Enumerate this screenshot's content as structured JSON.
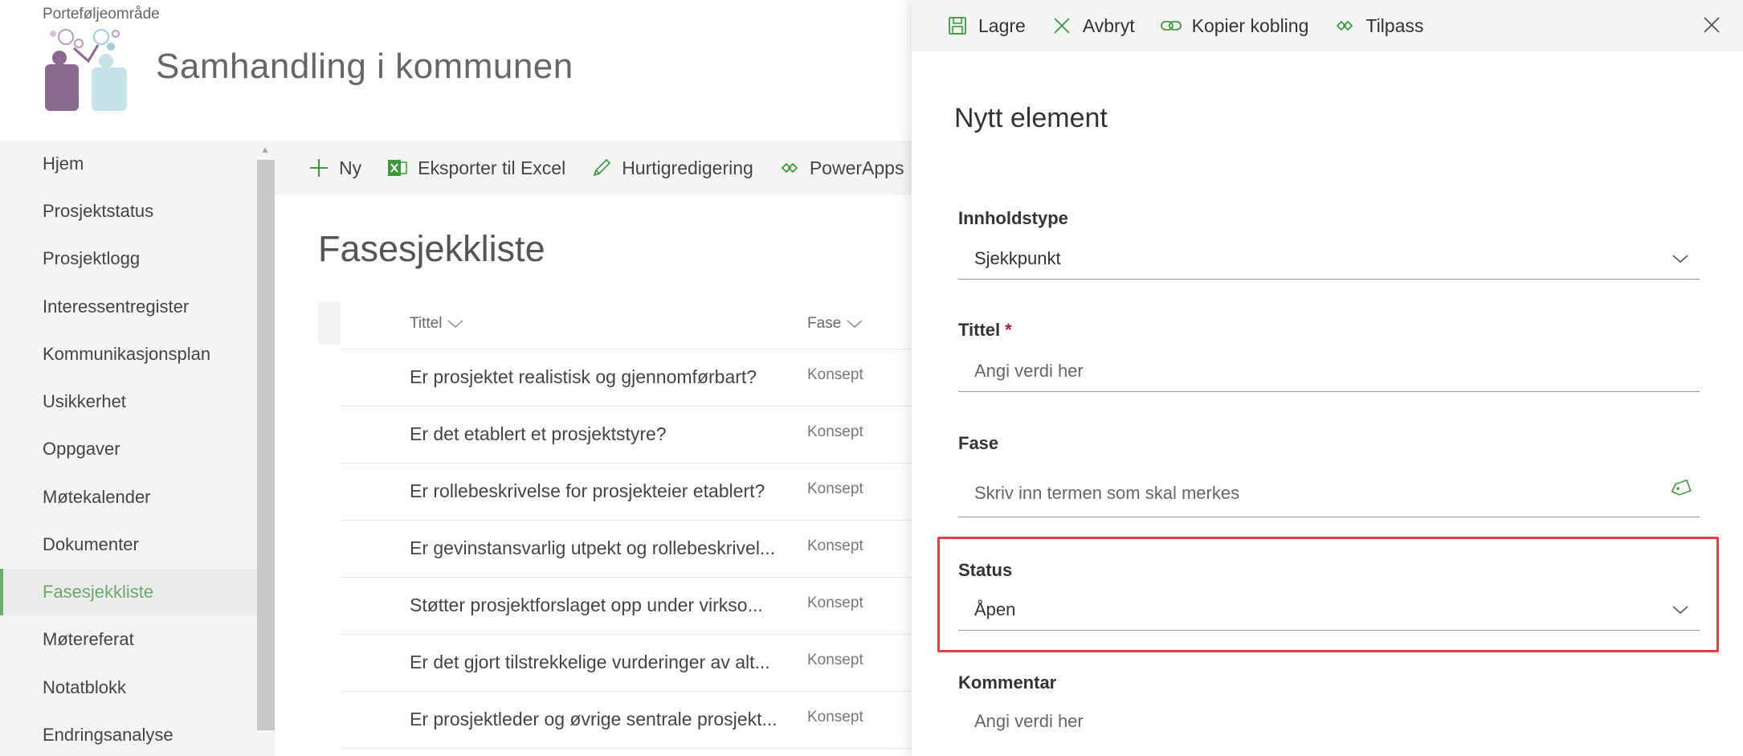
{
  "site": {
    "breadcrumb": "Porteføljeområde",
    "title": "Samhandling i kommunen"
  },
  "nav": {
    "items": [
      {
        "label": "Hjem"
      },
      {
        "label": "Prosjektstatus"
      },
      {
        "label": "Prosjektlogg"
      },
      {
        "label": "Interessentregister"
      },
      {
        "label": "Kommunikasjonsplan"
      },
      {
        "label": "Usikkerhet"
      },
      {
        "label": "Oppgaver"
      },
      {
        "label": "Møtekalender"
      },
      {
        "label": "Dokumenter"
      },
      {
        "label": "Fasesjekkliste"
      },
      {
        "label": "Møtereferat"
      },
      {
        "label": "Notatblokk"
      },
      {
        "label": "Endringsanalyse"
      }
    ],
    "active_index": 9
  },
  "commandbar": {
    "new": "Ny",
    "export": "Eksporter til Excel",
    "quickedit": "Hurtigredigering",
    "powerapps": "PowerApps"
  },
  "list": {
    "title": "Fasesjekkliste",
    "columns": {
      "title": "Tittel",
      "fase": "Fase"
    },
    "rows": [
      {
        "title": "Er prosjektet realistisk og gjennomførbart?",
        "fase": "Konsept"
      },
      {
        "title": "Er det etablert et prosjektstyre?",
        "fase": "Konsept"
      },
      {
        "title": "Er rollebeskrivelse for prosjekteier etablert?",
        "fase": "Konsept"
      },
      {
        "title": "Er gevinstansvarlig utpekt og rollebeskrivel...",
        "fase": "Konsept"
      },
      {
        "title": "Støtter prosjektforslaget opp under virkso...",
        "fase": "Konsept"
      },
      {
        "title": "Er det gjort tilstrekkelige vurderinger av alt...",
        "fase": "Konsept"
      },
      {
        "title": "Er prosjektleder og øvrige sentrale prosjekt...",
        "fase": "Konsept"
      }
    ]
  },
  "panel": {
    "commands": {
      "save": "Lagre",
      "cancel": "Avbryt",
      "copy_link": "Kopier kobling",
      "customize": "Tilpass"
    },
    "heading": "Nytt element",
    "fields": {
      "content_type": {
        "label": "Innholdstype",
        "value": "Sjekkpunkt"
      },
      "title": {
        "label": "Tittel",
        "required_mark": "*",
        "placeholder": "Angi verdi her"
      },
      "fase": {
        "label": "Fase",
        "placeholder": "Skriv inn termen som skal merkes"
      },
      "status": {
        "label": "Status",
        "value": "Åpen"
      },
      "comment": {
        "label": "Kommentar",
        "placeholder": "Angi verdi her"
      }
    }
  },
  "colors": {
    "accent_green": "#6aaa6a",
    "icon_green": "#3c9a3c",
    "highlight_red": "#e04040",
    "required_red": "#a4262c"
  }
}
